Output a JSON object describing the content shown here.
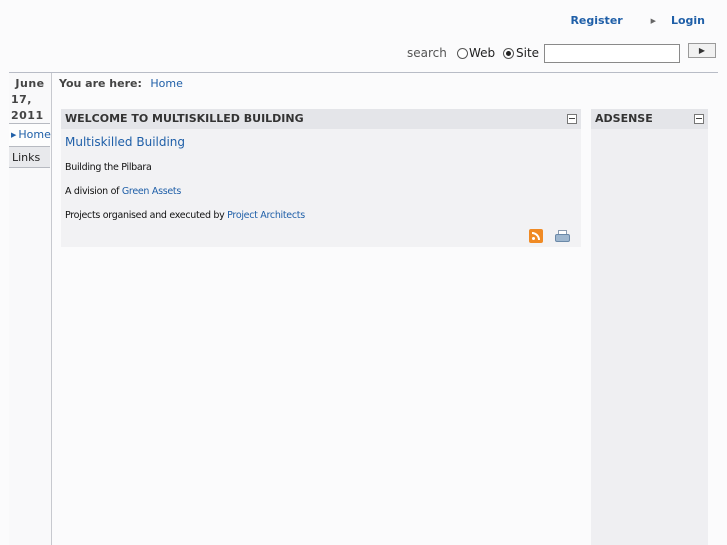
{
  "header": {
    "register_label": "Register",
    "login_label": "Login"
  },
  "search": {
    "label": "search",
    "options": [
      "Web",
      "Site"
    ],
    "selected": "Site",
    "input_value": "",
    "go_icon": "play-arrow-icon"
  },
  "sidebar": {
    "date": [
      "June",
      "17,",
      "2011"
    ],
    "items": [
      {
        "label": "Home",
        "active": true
      },
      {
        "label": "Links",
        "active": false
      }
    ]
  },
  "breadcrumb": {
    "label": "You are here:",
    "items": [
      "Home"
    ]
  },
  "main": {
    "panel_title": "WELCOME TO MULTISKILLED BUILDING",
    "heading": "Multiskilled Building",
    "line1": "Building the Pilbara",
    "line2_prefix": "A division of ",
    "line2_link": "Green Assets",
    "line3_prefix": "Projects organised and executed by ",
    "line3_link": "Project Architects",
    "icons": [
      "rss-icon",
      "print-icon"
    ]
  },
  "adsense": {
    "title": "ADSENSE"
  },
  "colors": {
    "link": "#1f5fa8",
    "panel_bg": "#f2f2f4",
    "header_bg": "#e4e5e9",
    "rss": "#f08a24"
  }
}
